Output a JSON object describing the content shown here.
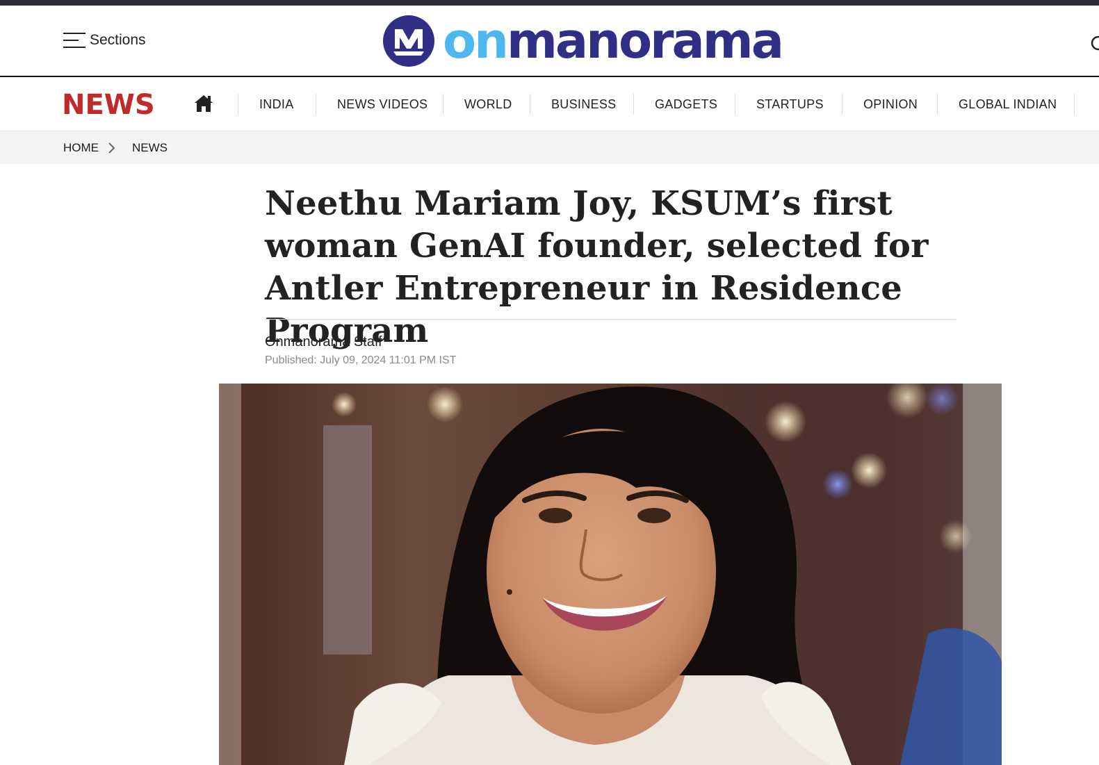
{
  "header": {
    "sections_label": "Sections",
    "logo": {
      "on": "on",
      "rest": "manorama"
    }
  },
  "nav": {
    "brand": "NEWS",
    "items": [
      {
        "label": "INDIA"
      },
      {
        "label": "NEWS VIDEOS"
      },
      {
        "label": "WORLD"
      },
      {
        "label": "BUSINESS"
      },
      {
        "label": "GADGETS"
      },
      {
        "label": "STARTUPS"
      },
      {
        "label": "OPINION"
      },
      {
        "label": "GLOBAL INDIAN"
      }
    ]
  },
  "breadcrumb": {
    "items": [
      {
        "label": "HOME"
      },
      {
        "label": "NEWS"
      }
    ]
  },
  "article": {
    "headline": "Neethu Mariam Joy, KSUM’s first woman GenAI founder, selected for Antler Entrepreneur in Residence Program",
    "author": "Onmanorama Staff",
    "published": "Published: July 09, 2024 11:01 PM IST"
  },
  "colors": {
    "brand_red": "#c12a2a",
    "logo_navy": "#2f2f86",
    "logo_sky": "#4db8ef",
    "top_strip": "#2b2b33"
  },
  "icons": {
    "menu": "hamburger-icon",
    "home": "home-icon",
    "breadcrumb_separator": "chevron-right-icon",
    "search": "search-icon",
    "logo": "manorama-m-logo"
  }
}
